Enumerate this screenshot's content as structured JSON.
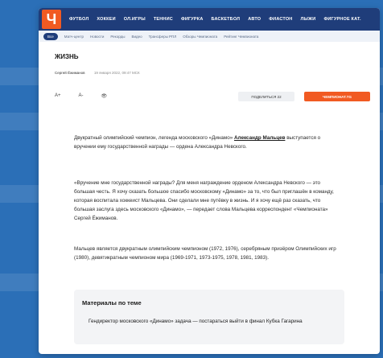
{
  "nav": {
    "logo": "Ч",
    "items": [
      "ФУТБОЛ",
      "ХОККЕЙ",
      "ОЛ.ИГРЫ",
      "ТЕННИС",
      "ФИГУРКА",
      "БАСКЕТБОЛ",
      "АВТО",
      "ФИАСТОН",
      "ЛЫЖИ",
      "ФИГУРНОЕ КАТ."
    ]
  },
  "subnav": {
    "pill": "Все",
    "items": [
      "Матч-центр",
      "Новости",
      "Рекорды",
      "Видео",
      "Трансферы РПЛ",
      "Обзоры Чемпионата",
      "Рейтинг Чемпионата"
    ]
  },
  "section_title": "ЖИЗНЬ",
  "meta": {
    "author": "Сергей Ёжиманов",
    "date": "19 января 2022, 09:47 МСК"
  },
  "toolbar": {
    "font_up": "A+",
    "font_down": "A-",
    "view": "👁"
  },
  "actions": {
    "share": "ПОДЕЛИТЬСЯ 22",
    "subscribe": "ЧЕМПИОНАТ.TG"
  },
  "article": {
    "p1_start": "Двукратный олимпийский чемпион, легенда московского «Динамо»",
    "p1_link": "Александр Мальцев",
    "p1_end": "выступается о вручении ему государственной награды — ордена Александра Невского.",
    "p2": "«Вручение мне государственной награды? Для меня награждение орденом Александра Невского — это большая честь. Я хочу сказать большое спасибо московскому «Динамо» за то, что был приглашён в команду, которая воспитала хоккеист Мальцева. Они сделали мне путёвку в жизнь. И я хочу ещё раз сказать, что большая заслуга здесь московского «Динамо», — передает слова Мальцева корреспондент «Чемпионата» Сергей Ёжиманов.",
    "p3": "Мальцев является двукратным олимпийским чемпионом (1972, 1976), серебряным призёром Олимпийских игр (1980), девятикратным чемпионом мира (1969-1971, 1973-1975, 1978, 1981, 1983)."
  },
  "related": {
    "title": "Материалы по теме",
    "link": "Гендиректор московского «Динамо» задача — постараться выйти в финал Кубка Гагарина"
  }
}
